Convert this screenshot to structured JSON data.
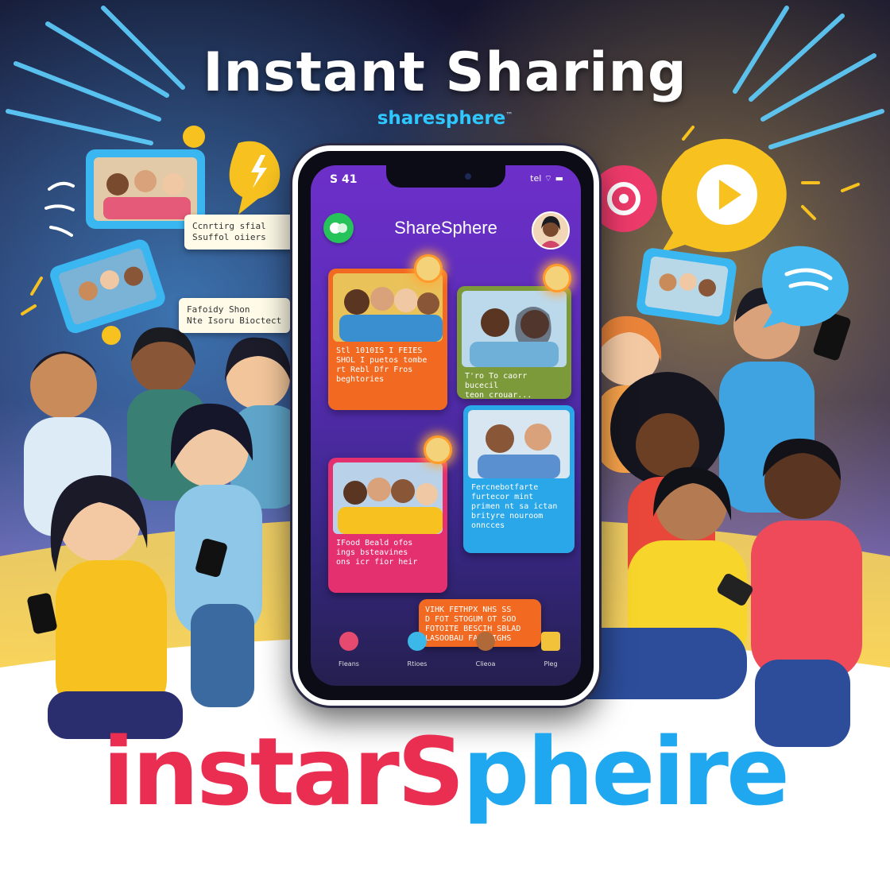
{
  "poster": {
    "headline": "Instant Sharing",
    "subbrand": "sharesphere",
    "subbrand_tm": "™",
    "bottom_logo_part1": "instarS",
    "bottom_logo_part2": "pheire"
  },
  "phone": {
    "status_time": "S 41",
    "status_icons": "tel ⌔ ▬",
    "app_title": "ShareSphere"
  },
  "posts": [
    {
      "caption": "Stl 1010IS I FEIES\nSHOL I puetos tombe\nrt Rebl Dfr Fros\nbeghtories"
    },
    {
      "caption": "T'ro To caorr bucecil\nteon crouar..."
    },
    {
      "caption": "Fercnebotfarte\nfurtecor mint\nprimen nt sa ictan\nbrityre nouroom\nonncces"
    },
    {
      "caption": "IFood Beald ofos\nings bsteavines\nons icr fior heir"
    },
    {
      "caption": "VIHK FETHPX NHS SS\nD FOT STOGUM OT SOO\nFOTOITE BESCIH SBLAD\nLASOOBAU FAN DIGHS"
    }
  ],
  "floating_cards": [
    {
      "text": "Ccnrtirg sfial\nSsuffol oiiers"
    },
    {
      "text": "Fafoidy Shon\nNte Isoru Bioctect"
    }
  ],
  "nav": [
    {
      "label": "Fleans",
      "color": "#e64a6e"
    },
    {
      "label": "Rtioes",
      "color": "#3bb8e8"
    },
    {
      "label": "Clieoa",
      "color": "#b06a3a"
    },
    {
      "label": "Pleg",
      "color": "#f2c23a"
    }
  ],
  "colors": {
    "background_top": "#171733",
    "background_bottom": "#ffffff",
    "accent_yellow": "#f7c21f",
    "accent_blue": "#1fa8f0",
    "accent_red": "#ea2e52"
  }
}
